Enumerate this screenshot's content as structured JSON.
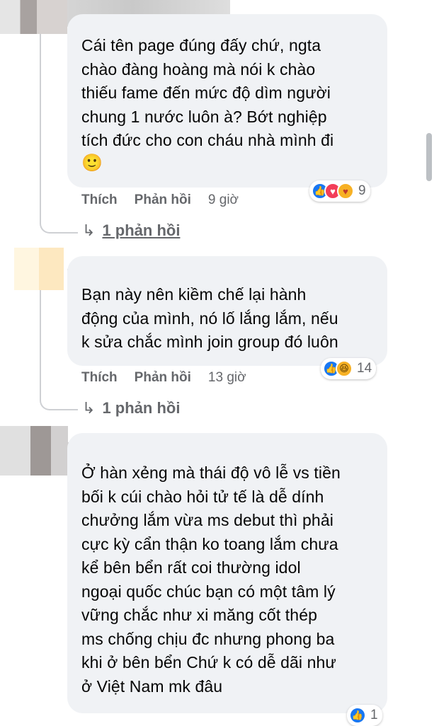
{
  "comments": [
    {
      "text": "Cái tên page đúng đấy chứ, ngta\nchào đàng hoàng mà nói k chào\nthiếu fame đến mức độ dìm người\nchung 1 nước luôn à? Bớt nghiệp\ntích đức cho con cháu nhà mình đi",
      "emoji": "🙂",
      "like_label": "Thích",
      "reply_label": "Phản hồi",
      "time": "9 giờ",
      "reaction_count": "9",
      "reactions": [
        "like-icon",
        "love-icon",
        "care-icon"
      ],
      "replies_label": "1 phản hồi"
    },
    {
      "text": "Bạn này nên kiềm chế lại hành\nđộng của mình, nó lố lắng lắm, nếu\nk sửa chắc mình join group đó luôn",
      "like_label": "Thích",
      "reply_label": "Phản hồi",
      "time": "13 giờ",
      "reaction_count": "14",
      "reactions": [
        "like-icon",
        "haha-icon"
      ],
      "replies_label": "1 phản hồi"
    },
    {
      "text": "Ở hàn xẻng mà thái độ vô lễ vs tiền\nbối k cúi chào hỏi tử tế là dễ dính\nchưởng lắm vừa ms debut thì phải\ncực kỳ cẩn thận ko toang lắm chưa\nkể bên bển rất coi thường idol\nngoại quốc chúc bạn có một tâm lý\nvững chắc như xi măng cốt thép\nms chống chịu đc nhưng phong ba\nkhi ở bên bển Chứ k có dễ dãi như\nở Việt Nam mk đâu",
      "reaction_count": "1",
      "reactions": [
        "like-icon"
      ]
    }
  ],
  "colors": {
    "bubble": "#f0f2f5",
    "meta_text": "#65676b",
    "like_blue": "#1877f2"
  }
}
